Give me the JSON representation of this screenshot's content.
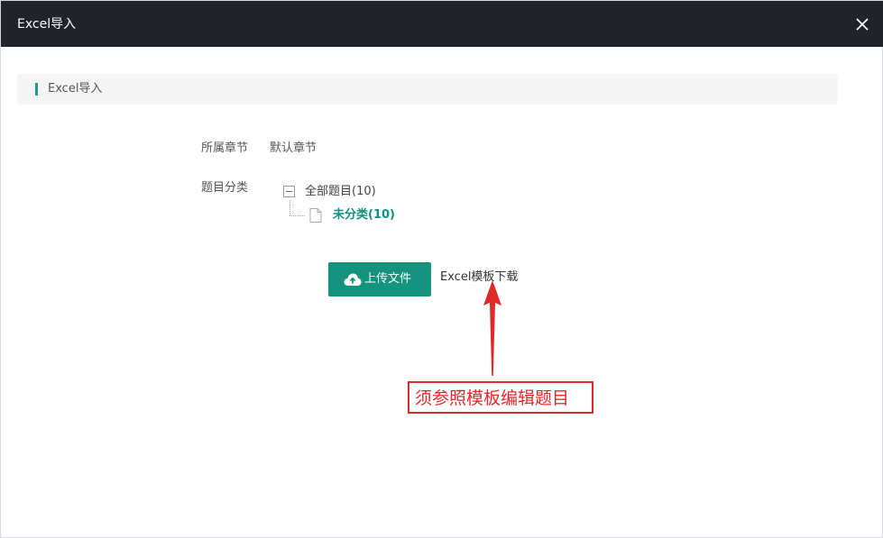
{
  "dialog": {
    "title": "Excel导入",
    "close_icon": "close-icon"
  },
  "section": {
    "title": "Excel导入",
    "accent_color": "#19a08e"
  },
  "form": {
    "chapter_label": "所属章节",
    "chapter_value": "默认章节",
    "category_label": "题目分类",
    "tree": {
      "root_label": "全部题目(10)",
      "root_state": "expanded",
      "children": [
        {
          "label": "未分类(10)",
          "icon": "file-icon",
          "selected": true
        }
      ]
    }
  },
  "actions": {
    "upload_label": "上传文件",
    "upload_icon": "cloud-upload-icon",
    "upload_color": "#14947f",
    "template_link": "Excel模板下载"
  },
  "annotation": {
    "text": "须参照模板编辑题目",
    "color": "#e02a2a"
  }
}
